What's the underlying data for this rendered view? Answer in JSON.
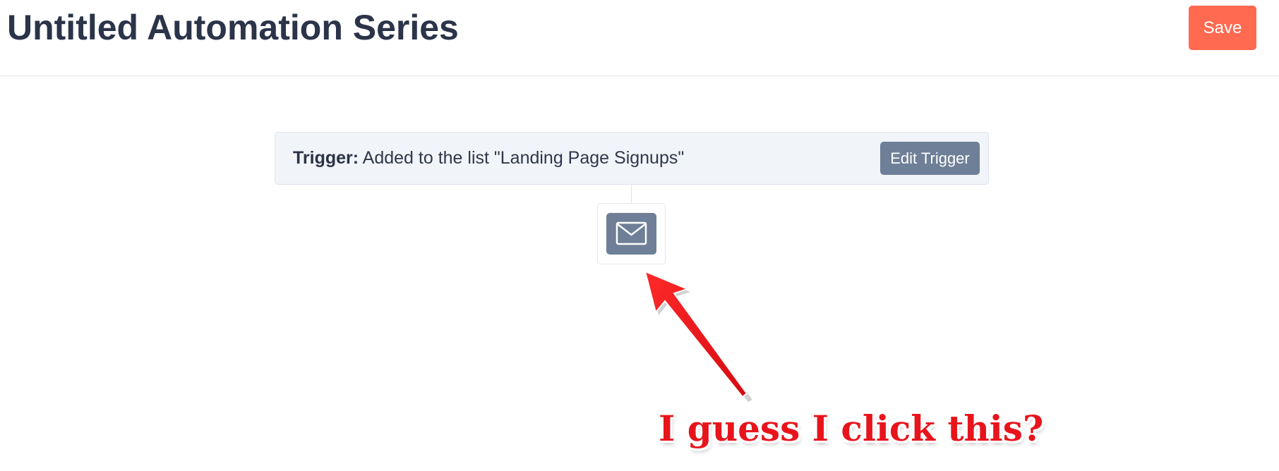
{
  "header": {
    "title": "Untitled Automation Series",
    "save_label": "Save"
  },
  "trigger": {
    "label": "Trigger:",
    "description": "Added to the list \"Landing Page Signups\"",
    "edit_label": "Edit Trigger"
  },
  "steps": [
    {
      "type": "email",
      "icon": "envelope-icon"
    }
  ],
  "annotation": {
    "text": "I guess I click this?",
    "arrow_icon": "red-arrow",
    "color": "#e8141c"
  },
  "colors": {
    "accent": "#ff6a50",
    "button_gray": "#6e7f97",
    "trigger_bg": "#f1f4f9",
    "title_text": "#2b3449"
  }
}
